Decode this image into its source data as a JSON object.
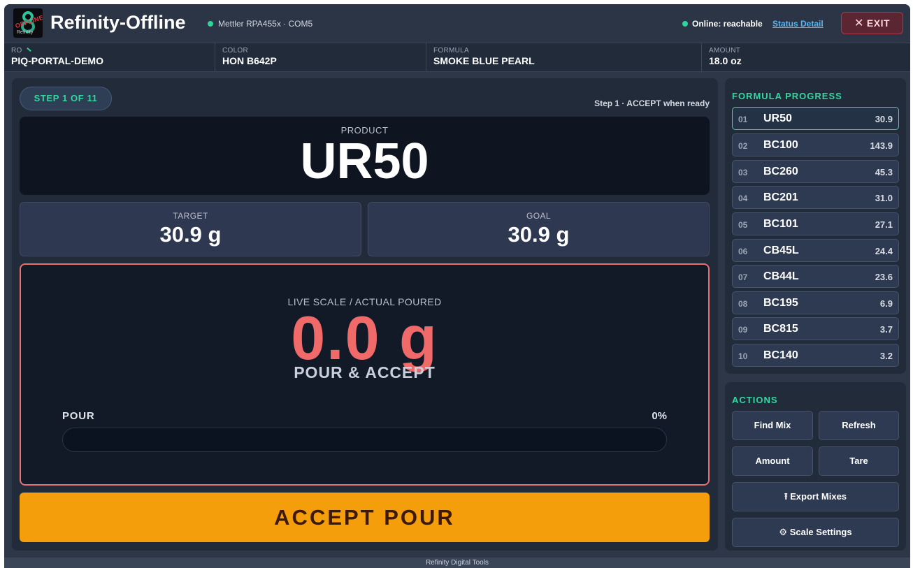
{
  "header": {
    "app_title": "Refinity-Offline",
    "logo_stamp": "OFFLINE",
    "logo_word": "Refinity",
    "scale_status": "Mettler RPA455x · COM5",
    "online_status": "Online: reachable",
    "status_link": "Status Detail",
    "exit_label": "EXIT",
    "exit_glyph": "✕"
  },
  "info": [
    {
      "label": "RO",
      "value": "PIQ-PORTAL-DEMO"
    },
    {
      "label": "COLOR",
      "value": "HON B642P"
    },
    {
      "label": "FORMULA",
      "value": "SMOKE BLUE PEARL"
    },
    {
      "label": "AMOUNT",
      "value": "18.0 oz"
    }
  ],
  "main": {
    "step_pill": "STEP 1 OF 11",
    "step_hint": "Step 1 · ACCEPT when ready",
    "product_label": "PRODUCT",
    "product_name": "UR50",
    "target_label": "TARGET",
    "target_value": "30.9 g",
    "goal_label": "GOAL",
    "goal_value": "30.9 g",
    "live_label": "LIVE SCALE / ACTUAL POURED",
    "live_reading": "0.0 g",
    "live_cta": "POUR & ACCEPT",
    "pour_label": "POUR",
    "pour_percent_text": "0%",
    "pour_fraction": 0,
    "accept_label": "ACCEPT POUR"
  },
  "progress": {
    "title": "FORMULA PROGRESS",
    "items": [
      {
        "num": "01",
        "code": "UR50",
        "amount": "30.9",
        "active": true
      },
      {
        "num": "02",
        "code": "BC100",
        "amount": "143.9",
        "active": false
      },
      {
        "num": "03",
        "code": "BC260",
        "amount": "45.3",
        "active": false
      },
      {
        "num": "04",
        "code": "BC201",
        "amount": "31.0",
        "active": false
      },
      {
        "num": "05",
        "code": "BC101",
        "amount": "27.1",
        "active": false
      },
      {
        "num": "06",
        "code": "CB45L",
        "amount": "24.4",
        "active": false
      },
      {
        "num": "07",
        "code": "CB44L",
        "amount": "23.6",
        "active": false
      },
      {
        "num": "08",
        "code": "BC195",
        "amount": "6.9",
        "active": false
      },
      {
        "num": "09",
        "code": "BC815",
        "amount": "3.7",
        "active": false
      },
      {
        "num": "10",
        "code": "BC140",
        "amount": "3.2",
        "active": false
      }
    ]
  },
  "actions": {
    "title": "ACTIONS",
    "find_mix": "Find Mix",
    "refresh": "Refresh",
    "amount": "Amount",
    "tare": "Tare",
    "export_mixes": "⭱ Export Mixes",
    "scale_settings": "⚙ Scale Settings"
  },
  "footer": {
    "text": "Refinity Digital Tools"
  },
  "colors": {
    "accent_green": "#35d6a0",
    "alert_red": "#f06a6a",
    "accept_orange": "#f59e0b",
    "link_blue": "#5db5f0"
  }
}
